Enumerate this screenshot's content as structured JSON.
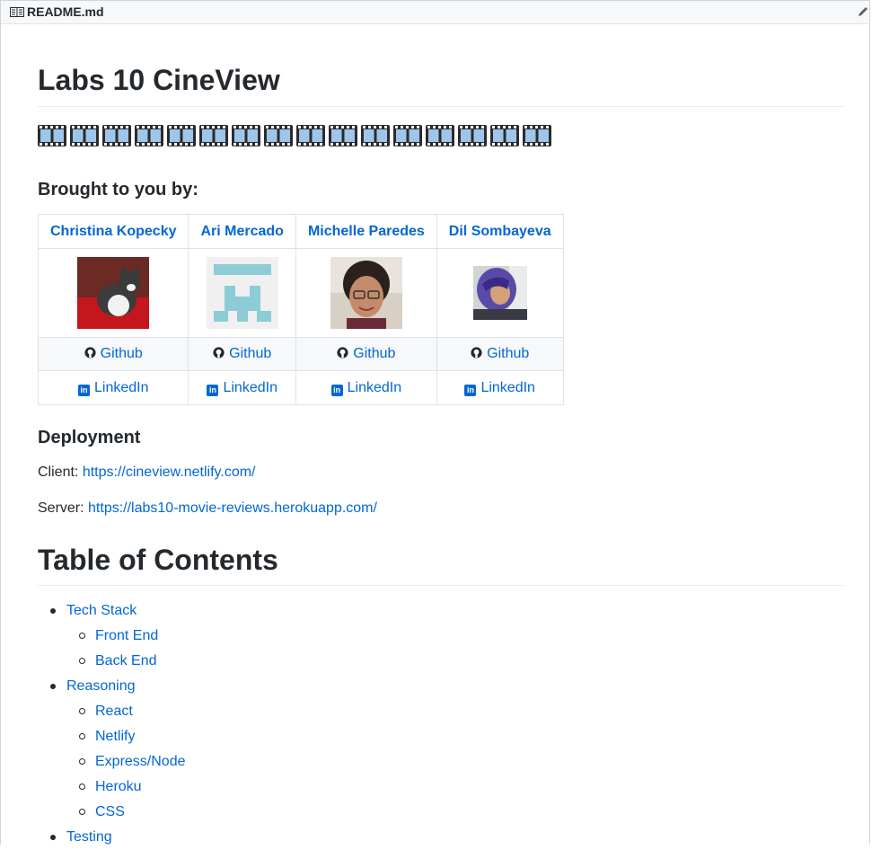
{
  "file_header": {
    "filename": "README.md",
    "icon": "book-icon",
    "edit_icon": "pencil-icon"
  },
  "title": "Labs 10 CineView",
  "film_strip": {
    "icon": "film-frames-icon",
    "count": 16
  },
  "team_section": {
    "heading": "Brought to you by:",
    "members": [
      {
        "name": "Christina Kopecky",
        "photo": "cat-photo",
        "github": "Github",
        "linkedin": "LinkedIn"
      },
      {
        "name": "Ari Mercado",
        "photo": "identicon",
        "github": "Github",
        "linkedin": "LinkedIn"
      },
      {
        "name": "Michelle Paredes",
        "photo": "portrait-photo",
        "github": "Github",
        "linkedin": "LinkedIn"
      },
      {
        "name": "Dil Sombayeva",
        "photo": "portrait-photo",
        "github": "Github",
        "linkedin": "LinkedIn"
      }
    ]
  },
  "deployment": {
    "heading": "Deployment",
    "client_label": "Client:",
    "client_url": "https://cineview.netlify.com/",
    "server_label": "Server:",
    "server_url": "https://labs10-movie-reviews.herokuapp.com/"
  },
  "toc": {
    "heading": "Table of Contents",
    "items": [
      {
        "label": "Tech Stack",
        "children": [
          {
            "label": "Front End"
          },
          {
            "label": "Back End"
          }
        ]
      },
      {
        "label": "Reasoning",
        "children": [
          {
            "label": "React"
          },
          {
            "label": "Netlify"
          },
          {
            "label": "Express/Node"
          },
          {
            "label": "Heroku"
          },
          {
            "label": "CSS"
          }
        ]
      },
      {
        "label": "Testing",
        "children": []
      }
    ]
  },
  "colors": {
    "link": "#0366d6",
    "text": "#24292e",
    "border": "#dfe2e5",
    "header_bg": "#f6f8fa"
  }
}
